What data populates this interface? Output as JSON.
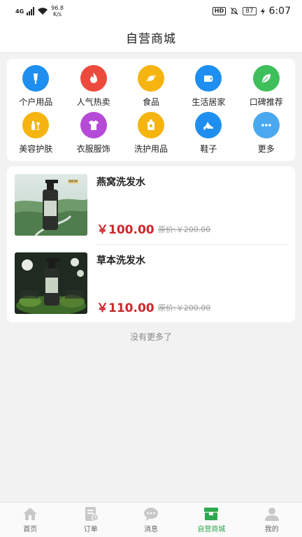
{
  "status_bar": {
    "network_type": "4G",
    "speed_value": "96.8",
    "speed_unit": "K/s",
    "hd": "HD",
    "battery": "87",
    "time": "6:07"
  },
  "header": {
    "title": "自营商城"
  },
  "categories": [
    {
      "label": "个户用品",
      "icon": "razor-icon",
      "color": "#1e8ff0"
    },
    {
      "label": "人气热卖",
      "icon": "flame-icon",
      "color": "#ec4a3c"
    },
    {
      "label": "食品",
      "icon": "candy-icon",
      "color": "#f5b40f"
    },
    {
      "label": "生活居家",
      "icon": "toilet-paper-icon",
      "color": "#1e8ff0"
    },
    {
      "label": "口碑推荐",
      "icon": "leaf-icon",
      "color": "#3fbf5c"
    },
    {
      "label": "美容护肤",
      "icon": "cosmetics-icon",
      "color": "#f5b40f"
    },
    {
      "label": "衣服服饰",
      "icon": "tshirt-icon",
      "color": "#b54ad8"
    },
    {
      "label": "洗护用品",
      "icon": "bottle-icon",
      "color": "#f5b40f"
    },
    {
      "label": "鞋子",
      "icon": "high-heel-icon",
      "color": "#1e8ff0"
    },
    {
      "label": "更多",
      "icon": "more-dots-icon",
      "color": "#4aa8f0"
    }
  ],
  "products": [
    {
      "name": "燕窝洗发水",
      "price": "￥100.00",
      "original_price": "原价:￥200.00",
      "image_badge": "NEW"
    },
    {
      "name": "草本洗发水",
      "price": "￥110.00",
      "original_price": "原价:￥200.00"
    }
  ],
  "footer_text": "没有更多了",
  "tabs": [
    {
      "label": "首页",
      "icon": "home-icon"
    },
    {
      "label": "订单",
      "icon": "order-icon"
    },
    {
      "label": "消息",
      "icon": "message-icon"
    },
    {
      "label": "自营商城",
      "icon": "store-icon",
      "active": true
    },
    {
      "label": "我的",
      "icon": "profile-icon"
    }
  ],
  "colors": {
    "accent": "#2fa84f",
    "price": "#d0262a",
    "inactive_tab": "#c8c8c8"
  }
}
